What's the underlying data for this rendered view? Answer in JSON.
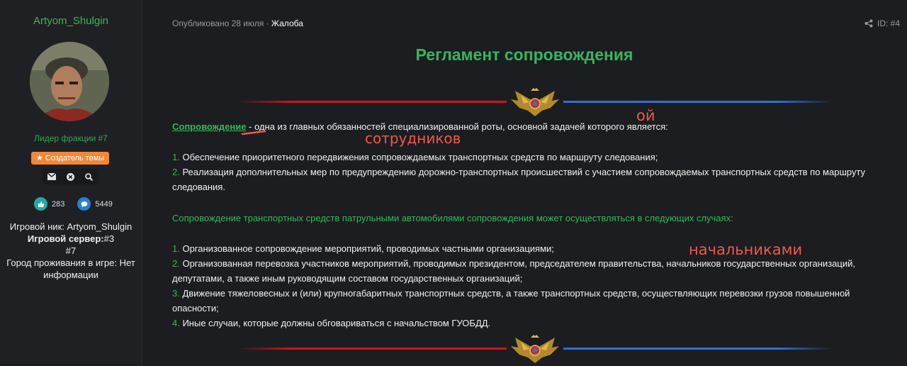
{
  "sidebar": {
    "username": "Artyom_Shulgin",
    "rank": "Лидер фракции #7",
    "badge_label": "Создатель темы",
    "stats": {
      "likes": "283",
      "messages": "5449"
    },
    "info": {
      "nick_label": "Игровой ник:",
      "nick_value": "Artyom_Shulgin",
      "server_label": "Игровой сервер:",
      "server_value": "#3",
      "server_value_2": "#7",
      "city_label": "Город проживания в игре:",
      "city_value": "Нет информации"
    }
  },
  "post": {
    "published": "Опубликовано 28 июля",
    "separator": "·",
    "category": "Жалоба",
    "id": "ID: #4",
    "title": "Регламент сопровождения",
    "def_term": "Сопровождение",
    "def_text": " - одна из главных обязанностей специализированной роты, основной задачей которого является:",
    "list1": [
      {
        "num": "1.",
        "text": " Обеспечение приоритетного передвижения сопровождаемых транспортных средств по маршруту следования;"
      },
      {
        "num": "2.",
        "text": " Реализация дополнительных мер по предупреждению дорожно-транспортных происшествий с участием сопровождаемых транспортных средств по маршруту следования."
      }
    ],
    "cases_heading": "Сопровождение транспортных средств патрульными автомобилями сопровождения может осуществляться в следующих случаях:",
    "list2": [
      {
        "num": "1.",
        "text": " Организованное сопровождение мероприятий, проводимых частными организациями;"
      },
      {
        "num": "2.",
        "text": " Организованная перевозка участников мероприятий, проводимых президентом, председателем правительства, начальников государственных организаций, депутатами, а также иным руководящим составом государственных организаций;"
      },
      {
        "num": "3.",
        "text": " Движение тяжеловесных и (или) крупногабаритных транспортных средств, а также транспортных средств, осуществляющих перевозки грузов повышенной опасности;"
      },
      {
        "num": "4.",
        "text": " Иные случаи, которые должны обговариваться с начальством ГУОБДД."
      }
    ]
  },
  "annotations": {
    "a1": "ой",
    "a2": "сотрудников",
    "a3": "начальниками"
  },
  "colors": {
    "green": "#36b65e",
    "red_line": "#d8101a",
    "blue_line": "#2f6fd8",
    "annotation": "#ee5a4a"
  },
  "icons": [
    "envelope-icon",
    "close-icon",
    "search-icon",
    "thumbs-up-icon",
    "chat-icon",
    "share-icon",
    "star-icon",
    "eagle-emblem-icon"
  ]
}
